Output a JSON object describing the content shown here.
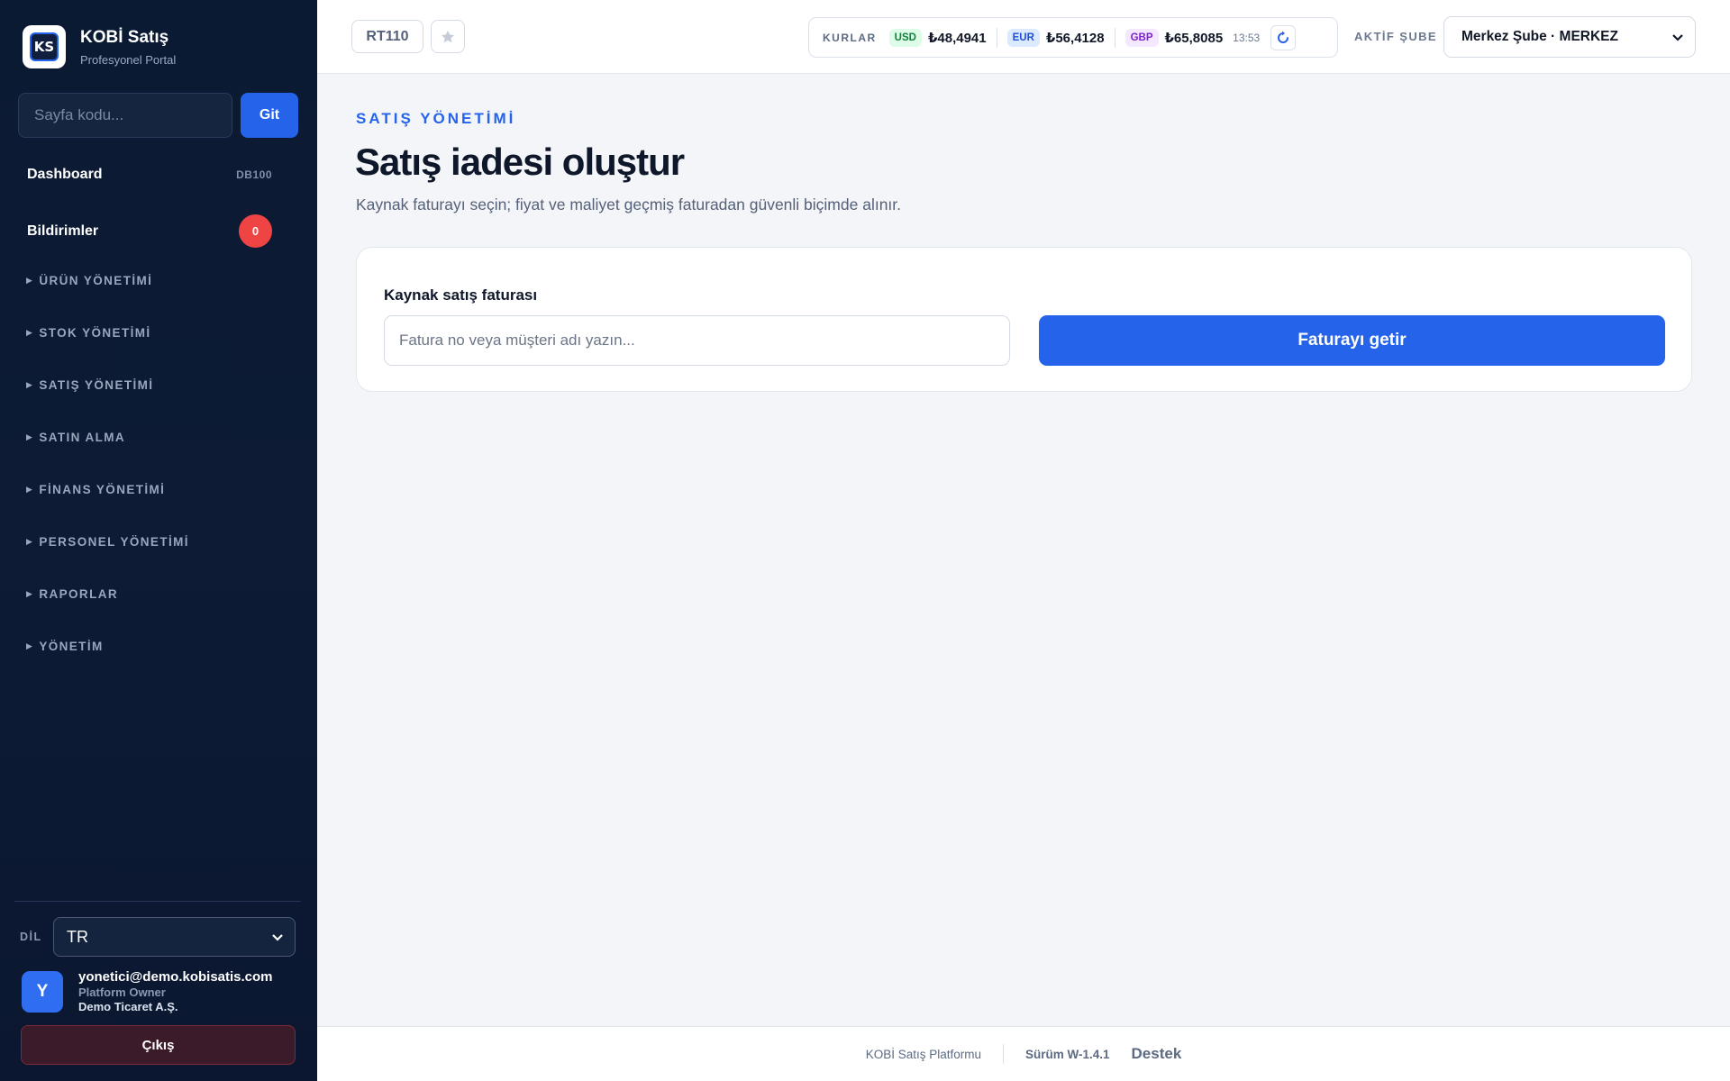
{
  "brand": {
    "title": "KOBİ Satış",
    "subtitle": "Profesyonel Portal",
    "logo_text": "KS"
  },
  "goto": {
    "placeholder": "Sayfa kodu...",
    "button": "Git"
  },
  "nav": {
    "dashboard": {
      "label": "Dashboard",
      "code": "DB100"
    },
    "notifications": {
      "label": "Bildirimler",
      "count": "0"
    },
    "groups": [
      "ÜRÜN YÖNETİMİ",
      "STOK YÖNETİMİ",
      "SATIŞ YÖNETİMİ",
      "SATIN ALMA",
      "FİNANS YÖNETİMİ",
      "PERSONEL YÖNETİMİ",
      "RAPORLAR",
      "YÖNETİM"
    ]
  },
  "language": {
    "label": "DİL",
    "value": "TR"
  },
  "user": {
    "initial": "Y",
    "email": "yonetici@demo.kobisatis.com",
    "role": "Platform Owner",
    "company": "Demo Ticaret A.Ş.",
    "logout": "Çıkış"
  },
  "topbar": {
    "page_code": "RT110",
    "rates_label": "KURLAR",
    "rates": [
      {
        "code": "USD",
        "value": "₺48,4941",
        "tag_bg": "#dcfce7",
        "tag_fg": "#15803d"
      },
      {
        "code": "EUR",
        "value": "₺56,4128",
        "tag_bg": "#dbeafe",
        "tag_fg": "#1d4ed8"
      },
      {
        "code": "GBP",
        "value": "₺65,8085",
        "tag_bg": "#f3e8ff",
        "tag_fg": "#7e22ce"
      }
    ],
    "rates_time": "13:53",
    "branch_label": "AKTİF ŞUBE",
    "branch_value": "Merkez Şube · MERKEZ"
  },
  "main": {
    "section": "SATIŞ YÖNETİMİ",
    "title": "Satış iadesi oluştur",
    "description": "Kaynak faturayı seçin; fiyat ve maliyet geçmiş faturadan güvenli biçimde alınır.",
    "card": {
      "label": "Kaynak satış faturası",
      "input_placeholder": "Fatura no veya müşteri adı yazın...",
      "button": "Faturayı getir"
    }
  },
  "footer": {
    "platform": "KOBİ Satış Platformu",
    "version": "Sürüm W-1.4.1",
    "support": "Destek"
  },
  "colors": {
    "accent": "#2563eb",
    "sidebar_bg": "#0b1a33",
    "danger": "#ef4444"
  }
}
